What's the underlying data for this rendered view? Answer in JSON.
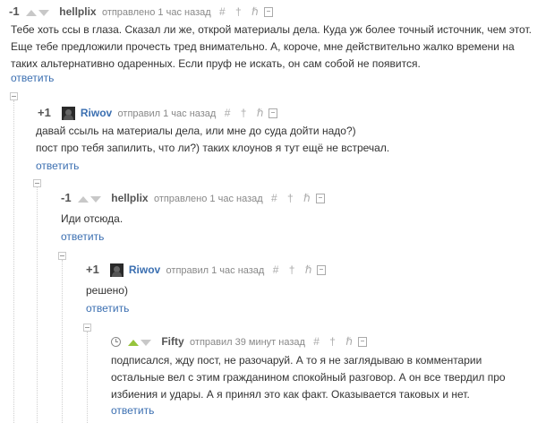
{
  "common": {
    "reply_label": "ответить",
    "tool_icons": "# † ℏ"
  },
  "comments": [
    {
      "rating": "-1",
      "author": "hellplix",
      "meta": "отправлено 1 час назад",
      "text": "Тебе хоть ссы в глаза. Сказал ли же, открой материалы дела. Куда уж более точный источник, чем этот. Еще тебе предложили прочесть тред внимательно. А, короче, мне действительно жалко времени на таких альтернативно одаренных. Если пруф не искать, он сам собой не появится."
    },
    {
      "rating": "+1",
      "author": "Riwov",
      "meta": "отправил 1 час назад",
      "text_line1": "давай ссыль на материалы дела, или мне до суда дойти надо?)",
      "text_line2": "пост про тебя запилить, что ли?) таких клоунов я тут ещё не встречал."
    },
    {
      "rating": "-1",
      "author": "hellplix",
      "meta": "отправлено 1 час назад",
      "text": "Иди отсюда."
    },
    {
      "rating": "+1",
      "author": "Riwov",
      "meta": "отправил 1 час назад",
      "text": "решено)"
    },
    {
      "rating": "",
      "author": "Fifty",
      "meta": "отправил 39 минут назад",
      "text": "подписался, жду пост, не разочаруй. А то я не заглядываю в комментарии остальные вел с этим гражданином спокойный разговор. А он все твердил про избиения и удары. А я принял это как факт. Оказывается таковых и нет."
    }
  ],
  "colors": {
    "link": "#3b6fb1",
    "vote_active": "#96c43c",
    "vote_inactive": "#c8c8c8"
  }
}
